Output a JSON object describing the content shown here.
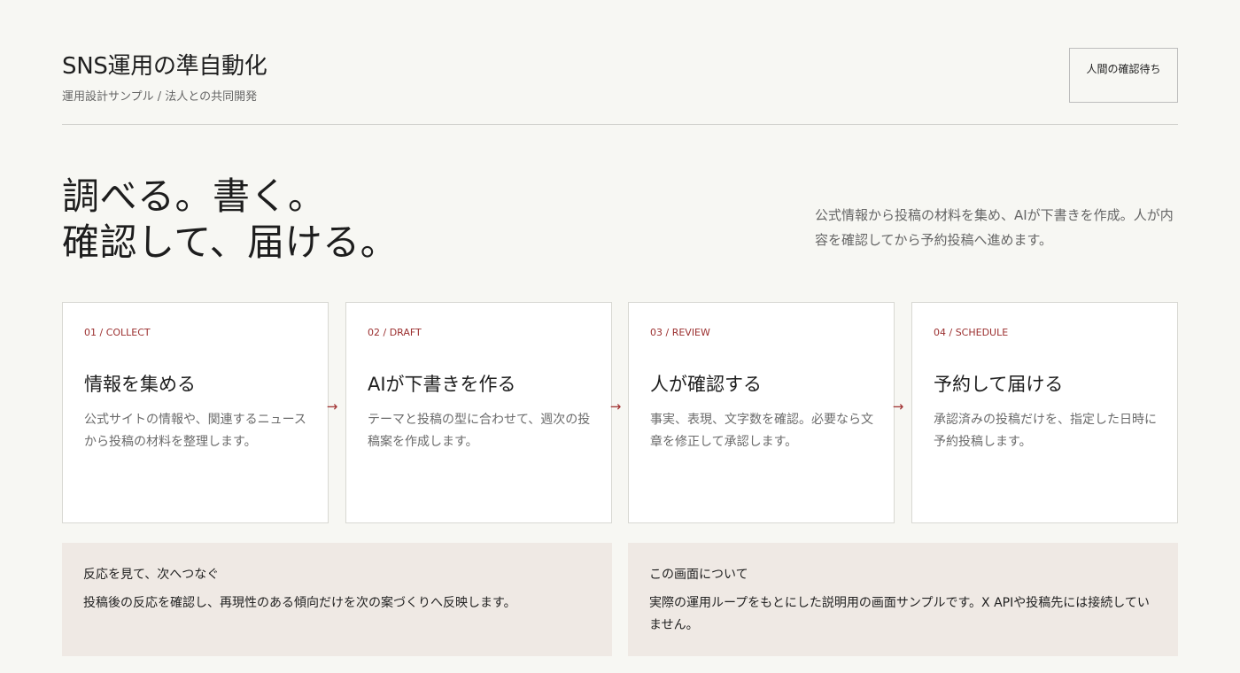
{
  "header": {
    "title": "SNS運用の準自動化",
    "subtitle": "運用設計サンプル / 法人との共同開発",
    "status_label": "人間の確認待ち"
  },
  "hero": {
    "title_line_1": "調べる。書く。",
    "title_line_2": "確認して、届ける。",
    "description": "公式情報から投稿の材料を集め、AIが下書きを作成。人が内容を確認してから予約投稿へ進めます。"
  },
  "steps": [
    {
      "code": "01 / COLLECT",
      "title": "情報を集める",
      "text": "公式サイトの情報や、関連するニュースから投稿の材料を整理します。"
    },
    {
      "code": "02 / DRAFT",
      "title": "AIが下書きを作る",
      "text": "テーマと投稿の型に合わせて、週次の投稿案を作成します。"
    },
    {
      "code": "03 / REVIEW",
      "title": "人が確認する",
      "text": "事実、表現、文字数を確認。必要なら文章を修正して承認します。"
    },
    {
      "code": "04 / SCHEDULE",
      "title": "予約して届ける",
      "text": "承認済みの投稿だけを、指定した日時に予約投稿します。"
    }
  ],
  "arrows": {
    "symbol": "→"
  },
  "notes": [
    {
      "title": "反応を見て、次へつなぐ",
      "text": "投稿後の反応を確認し、再現性のある傾向だけを次の案づくりへ反映します。"
    },
    {
      "title": "この画面について",
      "text": "実際の運用ループをもとにした説明用の画面サンプルです。X APIや投稿先には接続していません。"
    }
  ],
  "colors": {
    "background": "#f7f7f3",
    "accent": "#9b2f2f",
    "note_background": "#efe9e4",
    "card_background": "#ffffff"
  }
}
